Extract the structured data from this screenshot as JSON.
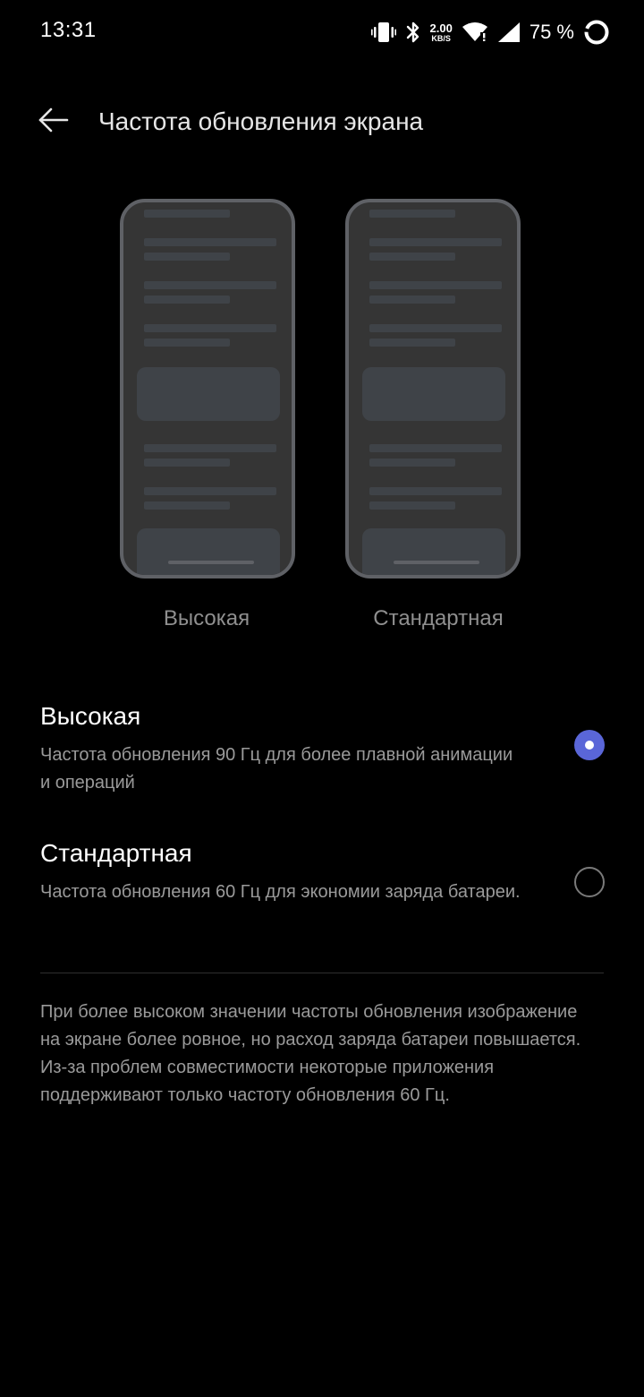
{
  "status_bar": {
    "time": "13:31",
    "net_speed_value": "2.00",
    "net_speed_unit": "KB/S",
    "battery_percent": "75 %",
    "icons": [
      "vibrate-icon",
      "bluetooth-icon",
      "wifi-icon",
      "cell-signal-icon",
      "battery-ring-icon"
    ]
  },
  "header": {
    "title": "Частота обновления экрана",
    "back_icon": "arrow-left-icon"
  },
  "previews": {
    "left_label": "Высокая",
    "right_label": "Стандартная"
  },
  "options": [
    {
      "title": "Высокая",
      "description": "Частота обновления 90 Гц для более плавной анимации и операций",
      "selected": true
    },
    {
      "title": "Стандартная",
      "description": "Частота обновления 60 Гц для экономии заряда батареи.",
      "selected": false
    }
  ],
  "footnote": "При более высоком значении частоты обновления изображение на экране более ровное, но расход заряда батареи повышается. Из-за проблем совместимости некоторые приложения поддерживают только частоту обновления 60 Гц.",
  "colors": {
    "accent": "#5a66d8",
    "background": "#000000"
  }
}
